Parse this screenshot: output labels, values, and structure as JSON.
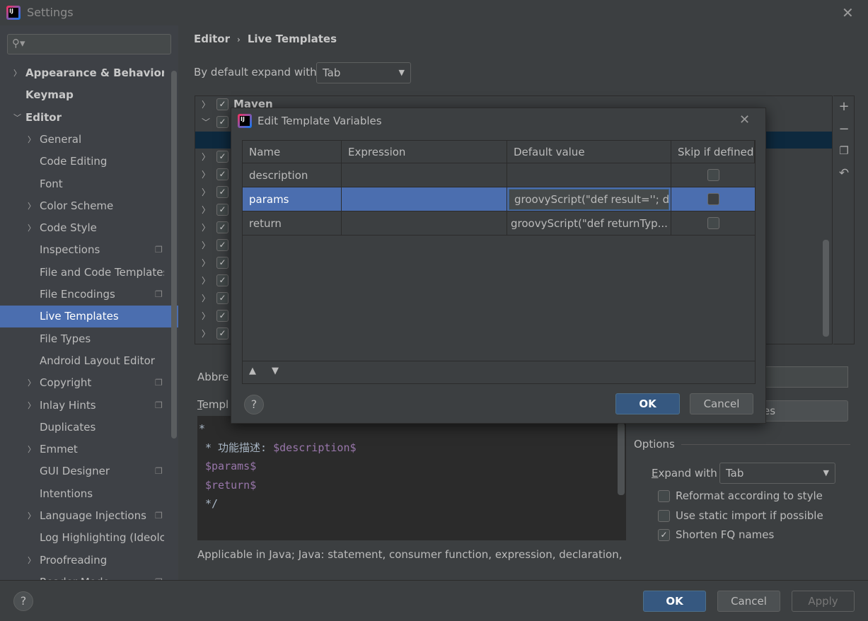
{
  "window": {
    "title": "Settings",
    "close_icon": "close-icon"
  },
  "sidebar": {
    "search_placeholder": "",
    "items": [
      {
        "label": "Appearance & Behavior",
        "bold": true,
        "chev": "right",
        "level": 0
      },
      {
        "label": "Keymap",
        "bold": true,
        "level": 0
      },
      {
        "label": "Editor",
        "bold": true,
        "chev": "down",
        "level": 0
      },
      {
        "label": "General",
        "chev": "right",
        "level": 1
      },
      {
        "label": "Code Editing",
        "level": 1
      },
      {
        "label": "Font",
        "level": 1
      },
      {
        "label": "Color Scheme",
        "chev": "right",
        "level": 1
      },
      {
        "label": "Code Style",
        "chev": "right",
        "level": 1
      },
      {
        "label": "Inspections",
        "level": 1,
        "copy": true
      },
      {
        "label": "File and Code Templates",
        "level": 1
      },
      {
        "label": "File Encodings",
        "level": 1,
        "copy": true
      },
      {
        "label": "Live Templates",
        "level": 1,
        "selected": true
      },
      {
        "label": "File Types",
        "level": 1
      },
      {
        "label": "Android Layout Editor",
        "level": 1
      },
      {
        "label": "Copyright",
        "chev": "right",
        "level": 1,
        "copy": true
      },
      {
        "label": "Inlay Hints",
        "chev": "right",
        "level": 1,
        "copy": true
      },
      {
        "label": "Duplicates",
        "level": 1
      },
      {
        "label": "Emmet",
        "chev": "right",
        "level": 1
      },
      {
        "label": "GUI Designer",
        "level": 1,
        "copy": true
      },
      {
        "label": "Intentions",
        "level": 1
      },
      {
        "label": "Language Injections",
        "chev": "right",
        "level": 1,
        "copy": true
      },
      {
        "label": "Log Highlighting (Ideolc",
        "level": 1
      },
      {
        "label": "Proofreading",
        "chev": "right",
        "level": 1
      },
      {
        "label": "Reader Mode",
        "level": 1,
        "copy": true
      }
    ]
  },
  "breadcrumb": [
    "Editor",
    "Live Templates"
  ],
  "expand_default": {
    "label": "By default expand with",
    "value": "Tab"
  },
  "tree": {
    "first_group": "Maven"
  },
  "dialog": {
    "title": "Edit Template Variables",
    "columns": [
      "Name",
      "Expression",
      "Default value",
      "Skip if defined"
    ],
    "rows": [
      {
        "name": "description",
        "expression": "",
        "default": "",
        "skip": false
      },
      {
        "name": "params",
        "expression": "",
        "default": "groovyScript(\"def result=''; de",
        "skip": false,
        "selected": true
      },
      {
        "name": "return",
        "expression": "",
        "default": "groovyScript(\"def returnTyp...",
        "skip": false
      }
    ],
    "ok": "OK",
    "cancel": "Cancel"
  },
  "details": {
    "abbreviation_label": "Abbre",
    "template_text_label": "Templ",
    "edit_variables_button": "es",
    "template_lines": [
      [
        "*",
        ""
      ],
      [
        " * 功能描述: ",
        "$description$"
      ],
      [
        "",
        "$params$"
      ],
      [
        "",
        "$return$"
      ],
      [
        "*/",
        ""
      ]
    ],
    "options_title": "Options",
    "expand_with_label": "Expand with",
    "expand_with_value": "Tab",
    "checkboxes": [
      {
        "label": "Reformat according to style",
        "checked": false
      },
      {
        "label": "Use static import if possible",
        "checked": false
      },
      {
        "label": "Shorten FQ names",
        "checked": true
      }
    ],
    "applicable": "Applicable in Java; Java: statement, consumer function, expression, declaration, com"
  },
  "footer": {
    "ok": "OK",
    "cancel": "Cancel",
    "apply": "Apply"
  },
  "colors": {
    "selection": "#4b6eaf",
    "primary_button": "#365880",
    "template_var": "#9876aa"
  }
}
